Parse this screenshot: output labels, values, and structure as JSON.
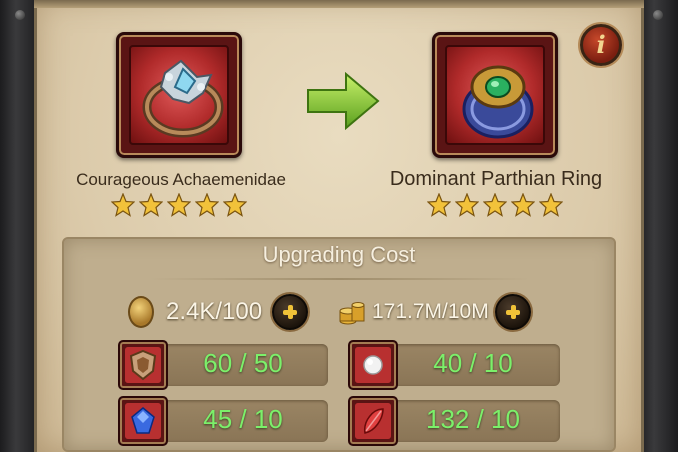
{
  "upgrade": {
    "from_item": {
      "name": "Courageous Achaemenidae",
      "stars": 5,
      "icon": "silver-ring-icon"
    },
    "to_item": {
      "name": "Dominant Parthian Ring",
      "stars": 5,
      "icon": "emerald-ring-icon"
    },
    "arrow_icon": "green-arrow-right-icon",
    "info_label": "i"
  },
  "cost": {
    "title": "Upgrading Cost",
    "medal": {
      "value": "2.4K/100",
      "icon": "medal-coin-icon"
    },
    "gold": {
      "value": "171.7M/10M",
      "icon": "gold-stack-icon"
    },
    "materials": [
      {
        "icon": "shield-crest-icon",
        "value": "60 / 50"
      },
      {
        "icon": "pearl-icon",
        "value": "40 / 10"
      },
      {
        "icon": "blue-gem-icon",
        "value": "45 / 10"
      },
      {
        "icon": "red-feather-icon",
        "value": "132 / 10"
      }
    ]
  },
  "colors": {
    "parchment": "#dccbab",
    "frame_red": "#5a1414",
    "value_green": "#7cf06a",
    "star_gold": "#f2c23a"
  }
}
